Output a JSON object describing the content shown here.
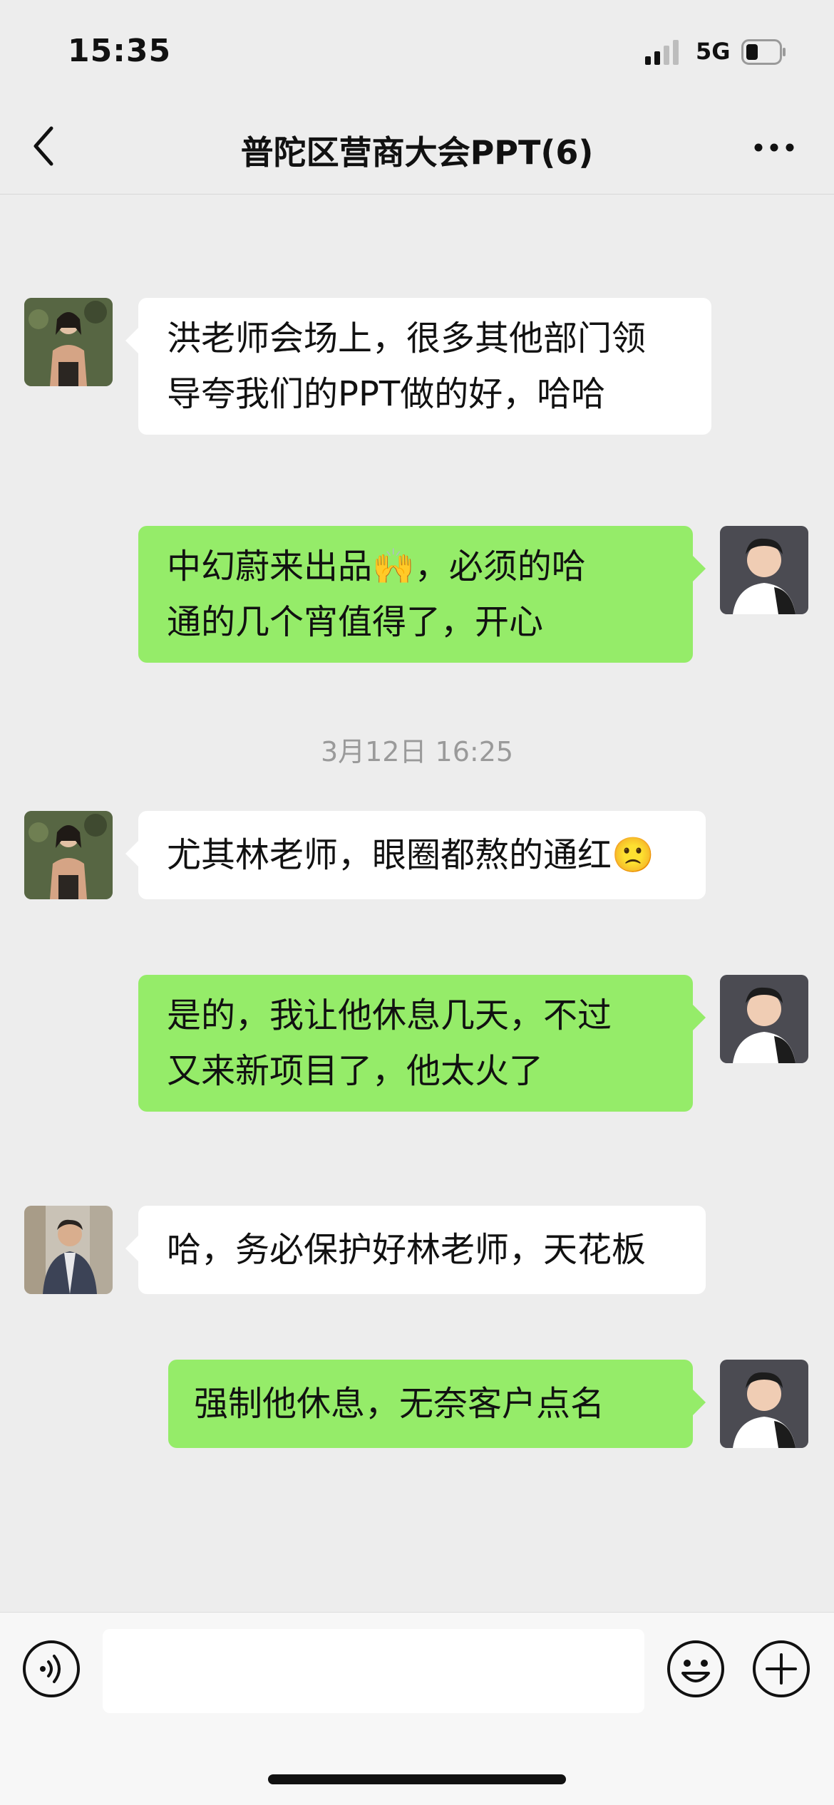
{
  "status_bar": {
    "time": "15:35",
    "network": "5G"
  },
  "header": {
    "title": "普陀区营商大会PPT(6)"
  },
  "timestamp": "3月12日 16:25",
  "messages": [
    {
      "side": "in",
      "line1": "洪老师会场上，很多其他部门领",
      "line2": "导夸我们的PPT做的好，哈哈"
    },
    {
      "side": "out",
      "line1a": "中幻蔚来出品",
      "emoji": "🙌",
      "line1b": "，必须的哈",
      "line2": "通的几个宵值得了，开心"
    },
    {
      "side": "in",
      "line1": "尤其林老师，眼圈都熬的通红",
      "emoji": "🙁"
    },
    {
      "side": "out",
      "line1": "是的，我让他休息几天，不过",
      "line2": "又来新项目了，他太火了"
    },
    {
      "side": "in",
      "line1": "哈，务必保护好林老师，天花板"
    },
    {
      "side": "out",
      "line1": "强制他休息，无奈客户点名"
    }
  ],
  "input": {
    "value": ""
  },
  "icons": [
    "back-icon",
    "more-icon",
    "voice-icon",
    "emoji-icon",
    "plus-icon",
    "signal-icon",
    "battery-icon"
  ],
  "colors": {
    "background": "#ededed",
    "incoming_bubble": "#ffffff",
    "outgoing_bubble": "#95ec69"
  }
}
